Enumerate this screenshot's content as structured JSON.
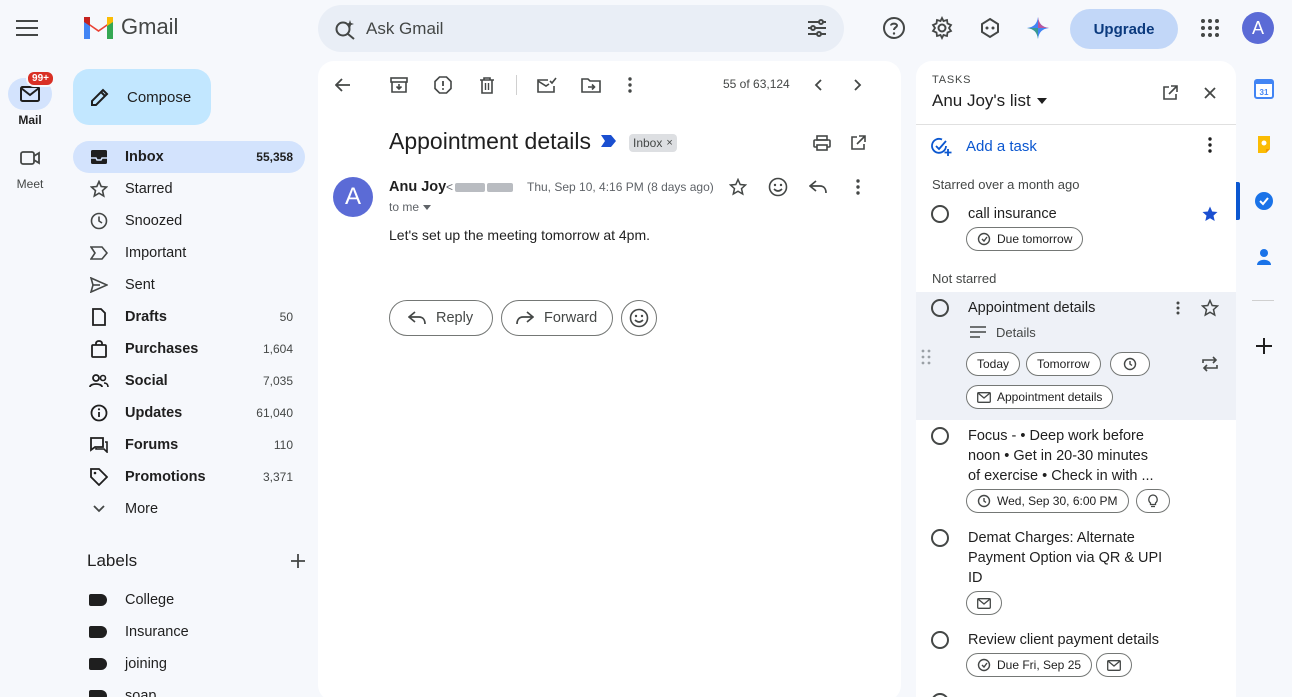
{
  "header": {
    "app_name": "Gmail",
    "search_placeholder": "Ask Gmail",
    "upgrade_label": "Upgrade",
    "account_initial": "A"
  },
  "rail": {
    "mail_label": "Mail",
    "mail_badge": "99+",
    "meet_label": "Meet"
  },
  "compose_label": "Compose",
  "nav": [
    {
      "label": "Inbox",
      "count": "55,358",
      "icon": "inbox-icon"
    },
    {
      "label": "Starred",
      "count": "",
      "icon": "star-icon"
    },
    {
      "label": "Snoozed",
      "count": "",
      "icon": "clock-icon"
    },
    {
      "label": "Important",
      "count": "",
      "icon": "important-icon"
    },
    {
      "label": "Sent",
      "count": "",
      "icon": "send-icon"
    },
    {
      "label": "Drafts",
      "count": "50",
      "icon": "draft-icon"
    },
    {
      "label": "Purchases",
      "count": "1,604",
      "icon": "shopping-bag-icon"
    },
    {
      "label": "Social",
      "count": "7,035",
      "icon": "people-icon"
    },
    {
      "label": "Updates",
      "count": "61,040",
      "icon": "info-icon"
    },
    {
      "label": "Forums",
      "count": "110",
      "icon": "forum-icon"
    },
    {
      "label": "Promotions",
      "count": "3,371",
      "icon": "tag-icon"
    },
    {
      "label": "More",
      "count": "",
      "icon": "chevron-down-icon"
    }
  ],
  "labels": {
    "heading": "Labels",
    "items": [
      "College",
      "Insurance",
      "joining",
      "soap"
    ]
  },
  "email": {
    "pager": "55 of 63,124",
    "subject": "Appointment details",
    "chip": "Inbox",
    "sender_name": "Anu Joy",
    "to": "to me",
    "date": "Thu, Sep 10, 4:16 PM (8 days ago)",
    "body": "Let's set up the meeting tomorrow at 4pm.",
    "reply_label": "Reply",
    "forward_label": "Forward"
  },
  "tasks": {
    "header_small": "TASKS",
    "list_name": "Anu Joy's list",
    "add_task": "Add a task",
    "section_starred": "Starred over a month ago",
    "section_not_starred": "Not starred",
    "items": [
      {
        "title": "call insurance",
        "chip": "Due tomorrow"
      },
      {
        "title": "Appointment details",
        "details": "Details",
        "today": "Today",
        "tomorrow": "Tomorrow",
        "link": "Appointment details"
      },
      {
        "title_lines": [
          "Focus - • Deep work before",
          "noon • Get in 20-30 minutes",
          "of exercise  • Check in with ..."
        ],
        "chip": "Wed, Sep 30, 6:00 PM"
      },
      {
        "title_lines": [
          "Demat Charges: Alternate",
          "Payment Option via QR & UPI",
          "ID"
        ]
      },
      {
        "title": "Review client payment details",
        "chip": "Due Fri, Sep 25"
      }
    ]
  },
  "colors": {
    "accent": "#0b57d0",
    "active_nav": "#d3e3fd",
    "compose": "#c2e7ff",
    "background": "#f6f8fc"
  }
}
